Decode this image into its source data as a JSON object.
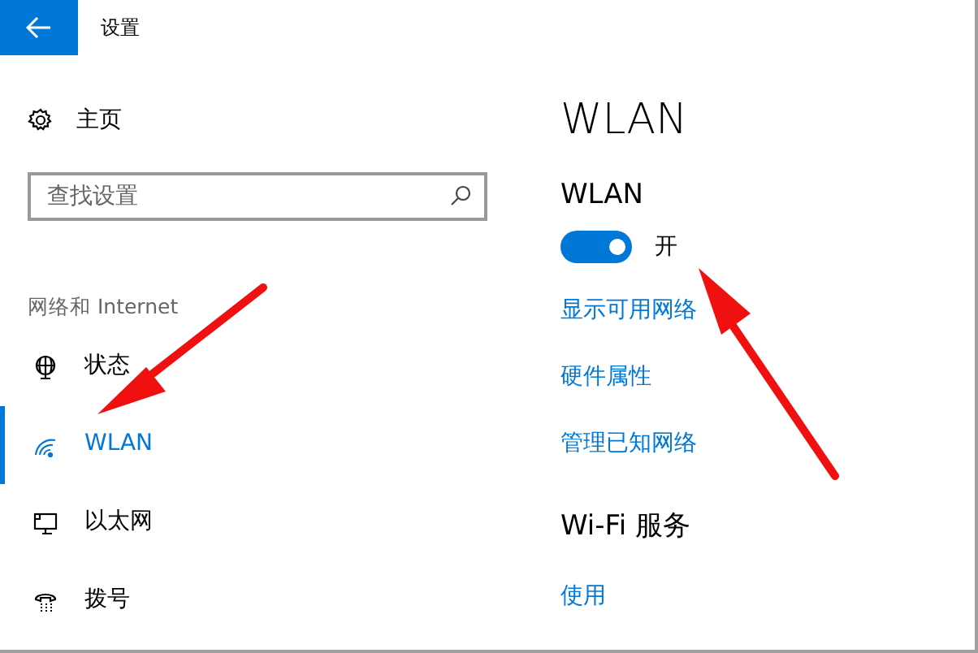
{
  "window": {
    "title": "设置"
  },
  "sidebar": {
    "home": "主页",
    "search": {
      "placeholder": "查找设置"
    },
    "section": "网络和 Internet",
    "items": [
      {
        "label": "状态",
        "kind": "globe",
        "selected": false
      },
      {
        "label": "WLAN",
        "kind": "wifi",
        "selected": true
      },
      {
        "label": "以太网",
        "kind": "ethernet",
        "selected": false
      },
      {
        "label": "拨号",
        "kind": "phone",
        "selected": false
      }
    ]
  },
  "content": {
    "title": "WLAN",
    "toggle": {
      "label": "WLAN",
      "on": true,
      "state_text": "开"
    },
    "links": [
      "显示可用网络",
      "硬件属性",
      "管理已知网络"
    ],
    "section": "Wi-Fi 服务",
    "section_link": "使用"
  }
}
